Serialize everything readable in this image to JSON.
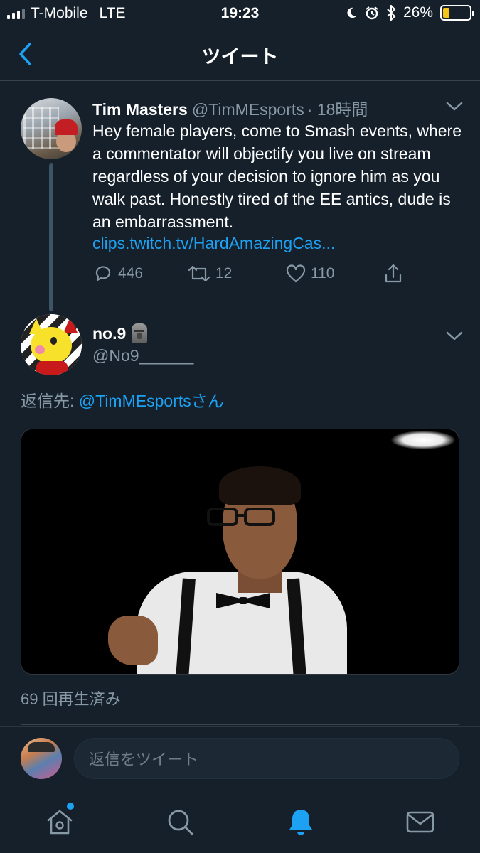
{
  "status_bar": {
    "carrier": "T-Mobile",
    "network": "LTE",
    "time": "19:23",
    "battery": "26%",
    "battery_level": 0.26,
    "battery_color": "#f5c518"
  },
  "nav": {
    "title": "ツイート",
    "back_icon": "chevron-left-icon"
  },
  "tweet1": {
    "name": "Tim Masters",
    "handle": "@TimMEsports",
    "time": "· 18時間",
    "text": "Hey female players, come to Smash events, where a commentator will objectify you live on stream regardless of your decision to ignore him as you walk past. Honestly tired of the EE antics, dude is an embarrassment.",
    "link": "clips.twitch.tv/HardAmazingCas...",
    "replies": "446",
    "retweets": "12",
    "likes": "110"
  },
  "tweet2": {
    "name": "no.9",
    "emoji": "moai-emoji",
    "handle": "@No9______",
    "reply_prefix": "返信先: ",
    "reply_mention": "@TimMEsportsさん",
    "views": "69 回再生済み"
  },
  "compose": {
    "placeholder": "返信をツイート"
  },
  "tabbar": {
    "items": [
      "home-icon",
      "search-icon",
      "notifications-icon",
      "messages-icon"
    ],
    "active": "notifications-icon"
  },
  "colors": {
    "background": "#15202b",
    "accent": "#1da1f2",
    "secondary_text": "#8899a6",
    "divider": "#38444d"
  }
}
